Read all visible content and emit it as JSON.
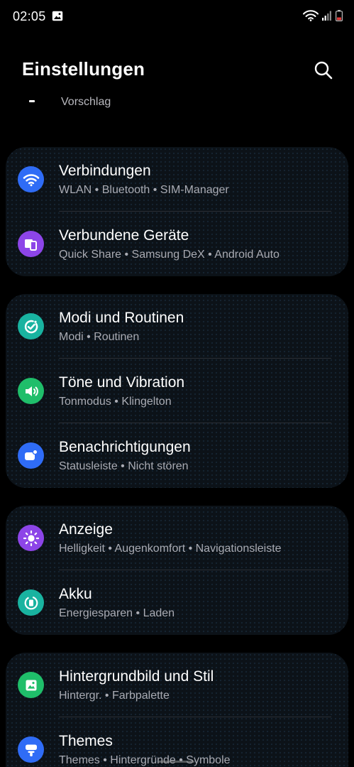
{
  "status_bar": {
    "time": "02:05",
    "icons": [
      "gallery-icon",
      "wifi-icon",
      "signal-icon",
      "battery-icon"
    ]
  },
  "header": {
    "title": "Einstellungen",
    "search_icon": "search-icon"
  },
  "suggestion": {
    "label": "Vorschlag"
  },
  "groups": [
    {
      "items": [
        {
          "title": "Verbindungen",
          "subtitle": "WLAN • Bluetooth • SIM-Manager",
          "icon": "wifi-icon",
          "color": "#2f6cf6"
        },
        {
          "title": "Verbundene Geräte",
          "subtitle": "Quick Share • Samsung DeX • Android Auto",
          "icon": "connected-devices-icon",
          "color": "#8d45e8"
        }
      ]
    },
    {
      "items": [
        {
          "title": "Modi und Routinen",
          "subtitle": "Modi • Routinen",
          "icon": "modes-routines-icon",
          "color": "#19b3a0"
        },
        {
          "title": "Töne und Vibration",
          "subtitle": "Tonmodus • Klingelton",
          "icon": "volume-icon",
          "color": "#1fbe6a"
        },
        {
          "title": "Benachrichtigungen",
          "subtitle": "Statusleiste • Nicht stören",
          "icon": "notifications-icon",
          "color": "#2f6cf6"
        }
      ]
    },
    {
      "items": [
        {
          "title": "Anzeige",
          "subtitle": "Helligkeit • Augenkomfort • Navigationsleiste",
          "icon": "brightness-icon",
          "color": "#8d45e8"
        },
        {
          "title": "Akku",
          "subtitle": "Energiesparen • Laden",
          "icon": "battery-icon",
          "color": "#19b3a0"
        }
      ]
    },
    {
      "items": [
        {
          "title": "Hintergrundbild und Stil",
          "subtitle": "Hintergr. • Farbpalette",
          "icon": "wallpaper-icon",
          "color": "#1fbe6a"
        },
        {
          "title": "Themes",
          "subtitle": "Themes • Hintergründe • Symbole",
          "icon": "themes-icon",
          "color": "#2f6cf6"
        }
      ]
    }
  ]
}
